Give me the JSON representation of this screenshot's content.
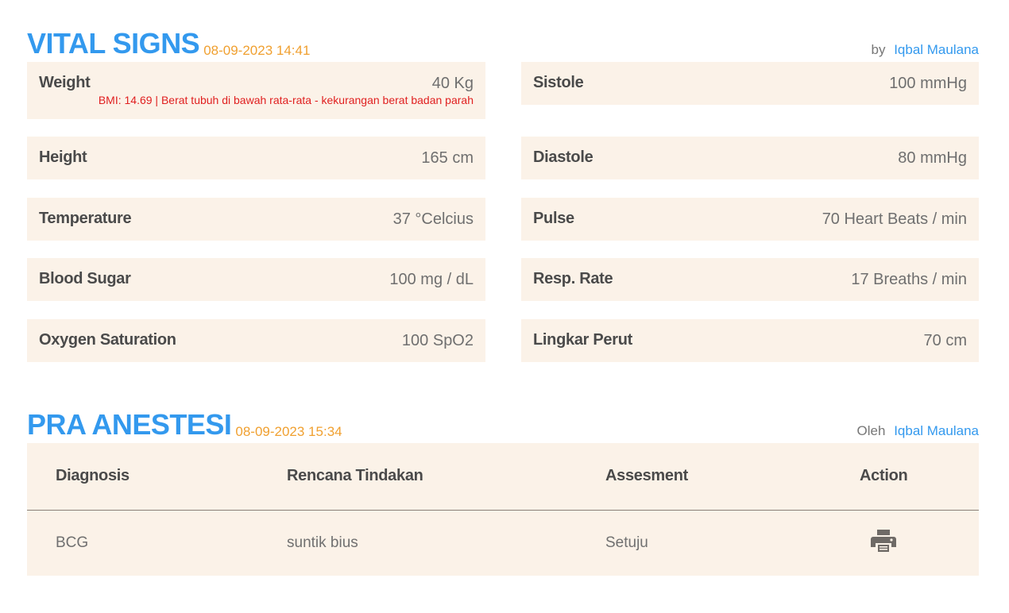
{
  "vital_signs": {
    "title": "VITAL SIGNS",
    "timestamp": "08-09-2023 14:41",
    "by_label": "by",
    "by_name": "Iqbal Maulana",
    "left": [
      {
        "label": "Weight",
        "value": "40 Kg",
        "note": "BMI: 14.69 | Berat tubuh di bawah rata-rata - kekurangan berat badan parah"
      },
      {
        "label": "Height",
        "value": "165 cm"
      },
      {
        "label": "Temperature",
        "value": "37 °Celcius"
      },
      {
        "label": "Blood Sugar",
        "value": "100 mg / dL"
      },
      {
        "label": "Oxygen Saturation",
        "value": "100 SpO2"
      }
    ],
    "right": [
      {
        "label": "Sistole",
        "value": "100 mmHg"
      },
      {
        "label": "Diastole",
        "value": "80 mmHg"
      },
      {
        "label": "Pulse",
        "value": "70 Heart Beats / min"
      },
      {
        "label": "Resp. Rate",
        "value": "17 Breaths / min"
      },
      {
        "label": "Lingkar Perut",
        "value": "70 cm"
      }
    ]
  },
  "pra_anestesi": {
    "title": "PRA ANESTESI",
    "timestamp": "08-09-2023 15:34",
    "by_label": "Oleh",
    "by_name": "Iqbal Maulana",
    "columns": [
      "Diagnosis",
      "Rencana Tindakan",
      "Assesment",
      "Action"
    ],
    "rows": [
      {
        "diagnosis": "BCG",
        "rencana": "suntik bius",
        "assesment": "Setuju",
        "action_icon": "printer-icon"
      }
    ]
  },
  "colors": {
    "accent": "#3399ee",
    "timestamp": "#f0a030",
    "card_bg": "#fbf2e8",
    "alert": "#e02020"
  }
}
